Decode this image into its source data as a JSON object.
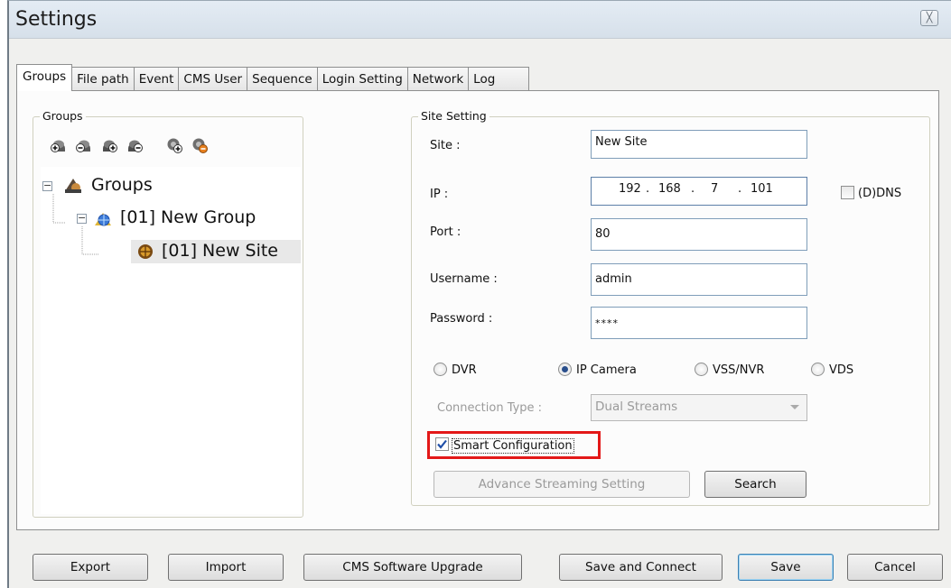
{
  "window": {
    "title": "Settings",
    "close_glyph": "╳"
  },
  "tabs": [
    {
      "label": "Groups",
      "active": true
    },
    {
      "label": "File path"
    },
    {
      "label": "Event"
    },
    {
      "label": "CMS User"
    },
    {
      "label": "Sequence"
    },
    {
      "label": "Login Setting"
    },
    {
      "label": "Network"
    },
    {
      "label": "Log"
    }
  ],
  "groups_panel": {
    "title": "Groups",
    "toolbar": [
      "add-group-icon",
      "remove-group-icon",
      "add-subgroup-icon",
      "remove-subgroup-icon",
      "add-site-icon",
      "remove-site-icon"
    ],
    "tree": {
      "root": "Groups",
      "group": "[01] New Group",
      "site": "[01] New Site"
    }
  },
  "site_setting": {
    "title": "Site Setting",
    "site_label": "Site :",
    "site_value": "New Site",
    "ip_label": "IP :",
    "ip": [
      "192",
      "168",
      "7",
      "101"
    ],
    "ddns_label": "(D)DNS",
    "port_label": "Port :",
    "port_value": "80",
    "username_label": "Username :",
    "username_value": "admin",
    "password_label": "Password :",
    "password_value": "****",
    "device_types": [
      {
        "label": "DVR",
        "checked": false
      },
      {
        "label": "IP Camera",
        "checked": true
      },
      {
        "label": "VSS/NVR",
        "checked": false
      },
      {
        "label": "VDS",
        "checked": false
      }
    ],
    "connection_type_label": "Connection Type :",
    "connection_type_value": "Dual Streams",
    "smart_config_label": "Smart Configuration",
    "smart_config_checked": true,
    "advance_button": "Advance Streaming Setting",
    "search_button": "Search"
  },
  "footer": {
    "export": "Export",
    "import": "Import",
    "upgrade": "CMS Software Upgrade",
    "save_connect": "Save and Connect",
    "save": "Save",
    "cancel": "Cancel"
  },
  "colors": {
    "highlight": "#e31818",
    "check": "#1f4fa8"
  }
}
